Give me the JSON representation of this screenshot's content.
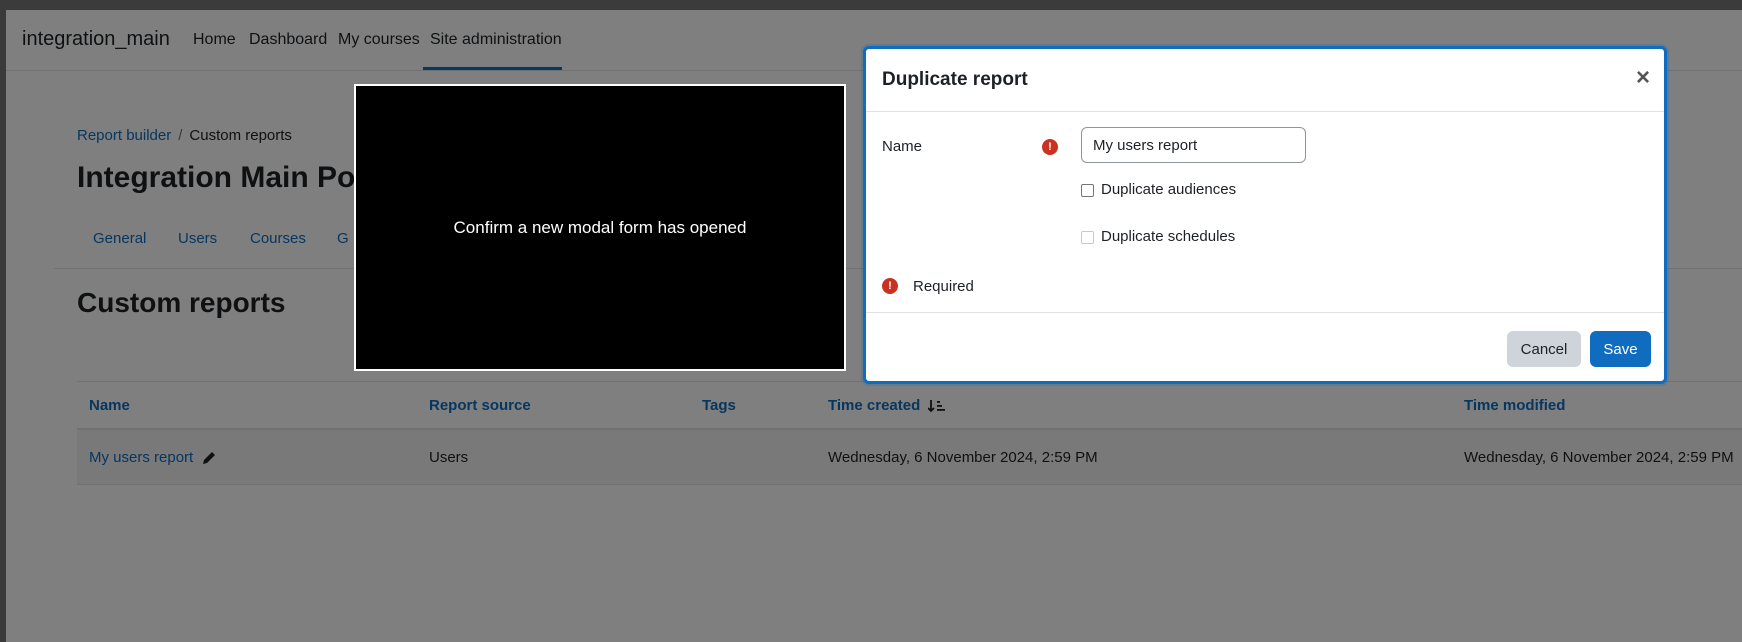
{
  "navbar": {
    "brand": "integration_main",
    "items": [
      "Home",
      "Dashboard",
      "My courses",
      "Site administration"
    ]
  },
  "breadcrumb": {
    "parent": "Report builder",
    "separator": "/",
    "current": "Custom reports"
  },
  "page_heading": "Integration Main Po",
  "secondary_nav": [
    "General",
    "Users",
    "Courses",
    "G"
  ],
  "section_title": "Custom reports",
  "table": {
    "headers": {
      "name": "Name",
      "source": "Report source",
      "tags": "Tags",
      "created": "Time created",
      "modified": "Time modified"
    },
    "rows": [
      {
        "name": "My users report",
        "source": "Users",
        "tags": "",
        "created": "Wednesday, 6 November 2024, 2:59 PM",
        "modified": "Wednesday, 6 November 2024, 2:59 PM"
      }
    ]
  },
  "overlay_message": "Confirm a new modal form has opened",
  "dialog": {
    "title": "Duplicate report",
    "close_symbol": "×",
    "name_label": "Name",
    "name_value": "My users report",
    "dup_audiences": "Duplicate audiences",
    "dup_schedules": "Duplicate schedules",
    "required": "Required",
    "cancel": "Cancel",
    "save": "Save"
  },
  "colors": {
    "accent": "#0f6cbf",
    "danger": "#ca3120",
    "overlay_bg": "#000000"
  }
}
